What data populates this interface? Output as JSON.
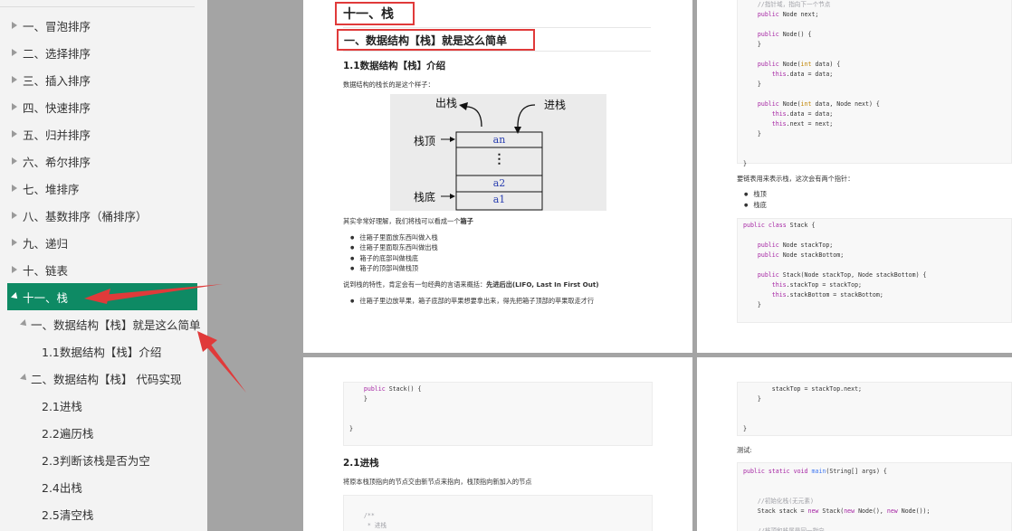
{
  "sidebar": {
    "items": [
      {
        "label": "一、冒泡排序",
        "level": 0,
        "state": "collapsed"
      },
      {
        "label": "二、选择排序",
        "level": 0,
        "state": "collapsed"
      },
      {
        "label": "三、插入排序",
        "level": 0,
        "state": "collapsed"
      },
      {
        "label": "四、快速排序",
        "level": 0,
        "state": "collapsed"
      },
      {
        "label": "五、归并排序",
        "level": 0,
        "state": "collapsed"
      },
      {
        "label": "六、希尔排序",
        "level": 0,
        "state": "collapsed"
      },
      {
        "label": "七、堆排序",
        "level": 0,
        "state": "collapsed"
      },
      {
        "label": "八、基数排序（桶排序）",
        "level": 0,
        "state": "collapsed"
      },
      {
        "label": "九、递归",
        "level": 0,
        "state": "collapsed"
      },
      {
        "label": "十、链表",
        "level": 0,
        "state": "collapsed"
      },
      {
        "label": "十一、栈",
        "level": 0,
        "state": "expanded",
        "active": true
      },
      {
        "label": "一、数据结构【栈】就是这么简单",
        "level": 1,
        "state": "expanded"
      },
      {
        "label": "1.1数据结构【栈】介绍",
        "level": 2,
        "state": "leaf"
      },
      {
        "label": "二、数据结构【栈】 代码实现",
        "level": 1,
        "state": "expanded"
      },
      {
        "label": "2.1进栈",
        "level": 2,
        "state": "leaf"
      },
      {
        "label": "2.2遍历栈",
        "level": 2,
        "state": "leaf"
      },
      {
        "label": "2.3判断该栈是否为空",
        "level": 2,
        "state": "leaf"
      },
      {
        "label": "2.4出栈",
        "level": 2,
        "state": "leaf"
      },
      {
        "label": "2.5清空栈",
        "level": 2,
        "state": "leaf"
      }
    ]
  },
  "colors": {
    "active_bg": "#0e8a64",
    "annotation_red": "#e03a3a",
    "app_bg": "#a4a4a4"
  },
  "page1": {
    "chapter_title": "十一、栈",
    "section_title": "一、数据结构【栈】就是这么简单",
    "sub_title": "1.1数据结构【栈】介绍",
    "intro": "数据结构的栈长的是这个样子：",
    "figure": {
      "out_label": "出栈",
      "in_label": "进栈",
      "top_label": "栈顶",
      "bottom_label": "栈底",
      "cells": [
        "an",
        "⋮",
        "a2",
        "a1"
      ]
    },
    "para1_pre": "其实非常好理解，我们将栈可以看成一个",
    "para1_bold": "箱子",
    "bullets": [
      "往箱子里面放东西叫做入栈",
      "往箱子里面取东西叫做出栈",
      "箱子的底部叫做栈底",
      "箱子的顶部叫做栈顶"
    ],
    "para2_pre": "说到栈的特性，肯定会有一句经典的言语来概括：",
    "para2_bold": "先进后出(LIFO, Last In First Out)",
    "bullet2": "往箱子里边放苹果，箱子底部的苹果想要拿出来，得先把箱子顶部的苹果取走才行"
  },
  "page2": {
    "code1": [
      "    //指针域，指向下一个节点",
      "    public Node next;",
      "",
      "    public Node() {",
      "    }",
      "",
      "    public Node(int data) {",
      "        this.data = data;",
      "    }",
      "",
      "    public Node(int data, Node next) {",
      "        this.data = data;",
      "        this.next = next;",
      "    }",
      "",
      "",
      "}"
    ],
    "text1": "要链表用来表示栈，这次会有两个指针：",
    "bullets": [
      "栈顶",
      "栈底"
    ],
    "code2": [
      "public class Stack {",
      "",
      "    public Node stackTop;",
      "    public Node stackBottom;",
      "",
      "    public Stack(Node stackTop, Node stackBottom) {",
      "        this.stackTop = stackTop;",
      "        this.stackBottom = stackBottom;",
      "    }"
    ]
  },
  "page3": {
    "code1": [
      "    public Stack() {",
      "    }",
      "",
      "",
      "}"
    ],
    "title": "2.1进栈",
    "text": "将原本栈顶指向的节点交由新节点来指向，栈顶指向新加入的节点",
    "code2": [
      "",
      "    /**",
      "     * 进栈"
    ]
  },
  "page4": {
    "code1": [
      "        stackTop = stackTop.next;",
      "    }",
      "",
      "",
      "}"
    ],
    "text": "测试:",
    "code2": [
      "public static void main(String[] args) {",
      "",
      "",
      "    //初始化栈(无元素)",
      "    Stack stack = new Stack(new Node(), new Node());",
      "",
      "    //栈顶和栈尾是同一指向"
    ]
  }
}
